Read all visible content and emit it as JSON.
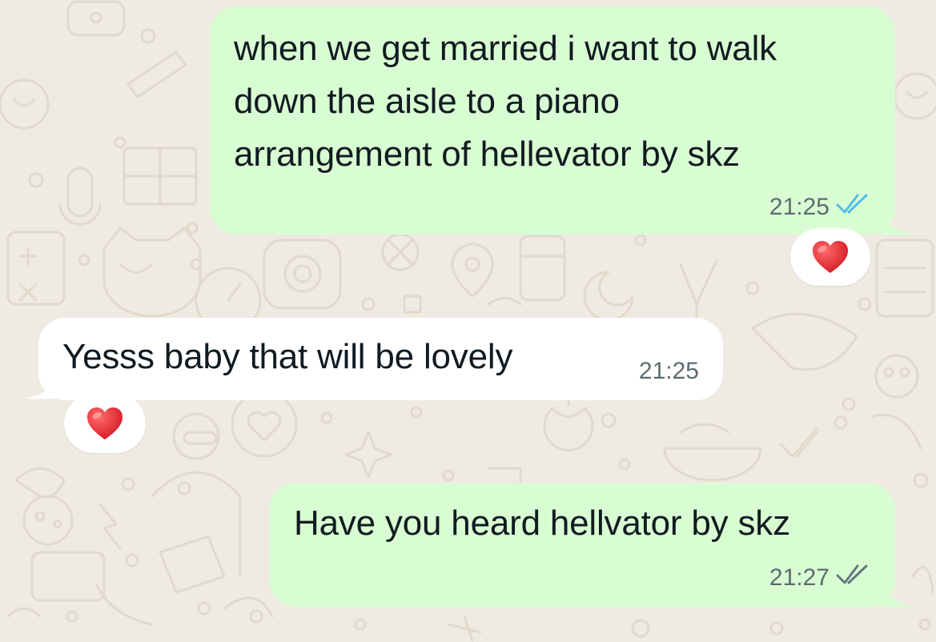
{
  "chat": {
    "messages": [
      {
        "direction": "outgoing",
        "text": "when we get married i want to walk\ndown the aisle to a piano\narrangement of hellevator by skz",
        "time": "21:25",
        "status": "read",
        "status_icon": "double-check-icon",
        "status_color": "#53bdeb",
        "reaction": "❤️"
      },
      {
        "direction": "incoming",
        "text": "Yesss baby that will be lovely",
        "time": "21:25",
        "reaction": "❤️"
      },
      {
        "direction": "outgoing",
        "text": "Have you heard hellvator by skz",
        "time": "21:27",
        "status": "delivered",
        "status_icon": "double-check-icon",
        "status_color": "#667781"
      }
    ]
  },
  "colors": {
    "wallpaper": "#efeae2",
    "outgoing_bubble": "#d9fdd3",
    "incoming_bubble": "#ffffff",
    "read_ticks": "#53bdeb",
    "sent_ticks": "#667781"
  }
}
